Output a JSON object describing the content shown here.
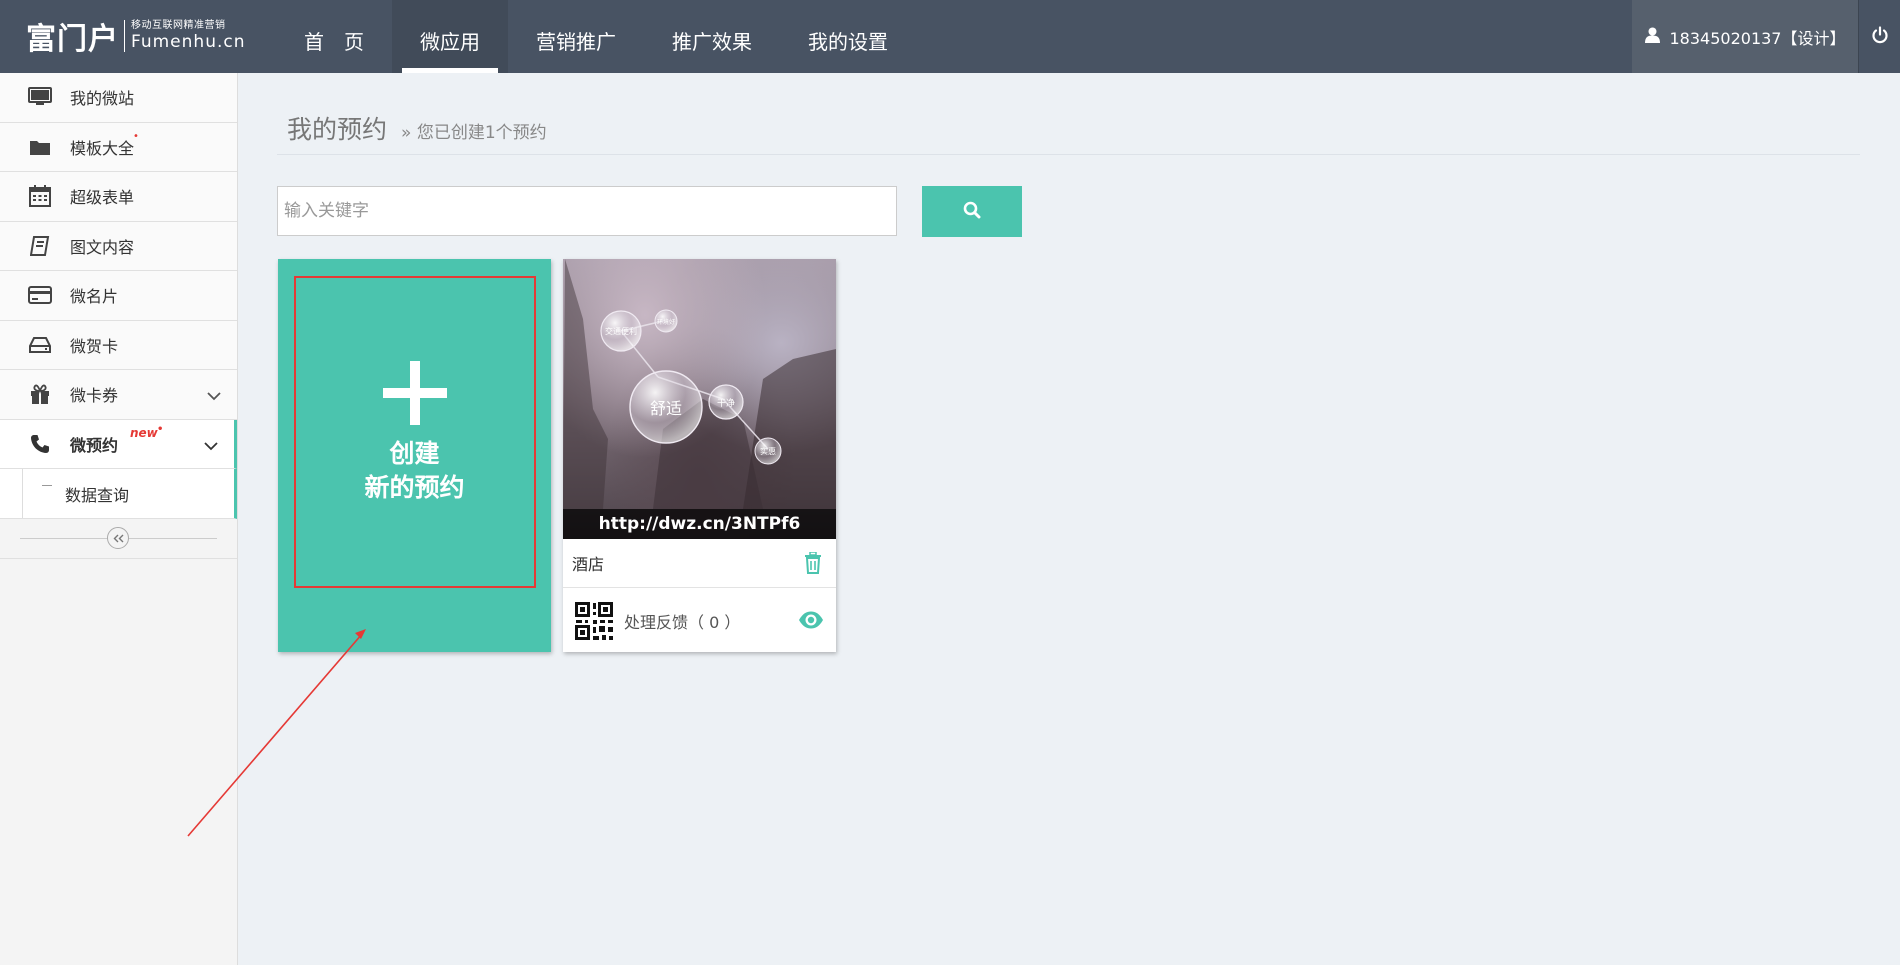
{
  "logo": {
    "main": "富门户",
    "tagline": "移动互联网精准营销",
    "domain": "Fumenhu.cn"
  },
  "nav": {
    "items": [
      {
        "label": "首　页"
      },
      {
        "label": "微应用"
      },
      {
        "label": "营销推广"
      },
      {
        "label": "推广效果"
      },
      {
        "label": "我的设置"
      }
    ],
    "active_index": 1
  },
  "user": {
    "name": "18345020137【设计】",
    "icon": "user-icon"
  },
  "power_icon": "power-icon",
  "sidebar": {
    "items": [
      {
        "label": "我的微站",
        "icon": "monitor-icon"
      },
      {
        "label": "模板大全",
        "icon": "folder-icon"
      },
      {
        "label": "超级表单",
        "icon": "calendar-icon"
      },
      {
        "label": "图文内容",
        "icon": "book-icon"
      },
      {
        "label": "微名片",
        "icon": "card-icon"
      },
      {
        "label": "微贺卡",
        "icon": "inbox-icon"
      },
      {
        "label": "微卡券",
        "icon": "gift-icon"
      },
      {
        "label": "微预约",
        "icon": "phone-icon",
        "badge": "new"
      }
    ],
    "sub_items": [
      {
        "label": "数据查询"
      }
    ],
    "collapse_icon": "double-chevron-left-icon"
  },
  "page": {
    "title": "我的预约",
    "subtitle": "» 您已创建1个预约"
  },
  "search": {
    "placeholder": "输入关键字",
    "value": "",
    "button_icon": "search-icon"
  },
  "create_card": {
    "line1": "创建",
    "line2": "新的预约"
  },
  "app_card": {
    "url": "http://dwz.cn/3NTPf6",
    "name": "酒店",
    "feedback_label": "处理反馈（ 0 ）",
    "bubble_labels": [
      "舒适",
      "干净",
      "实惠",
      "交通便利",
      "环境好"
    ]
  },
  "colors": {
    "topbar": "#485363",
    "accent": "#4bc4ae",
    "highlight_red": "#e53935",
    "background": "#edf1f5"
  }
}
